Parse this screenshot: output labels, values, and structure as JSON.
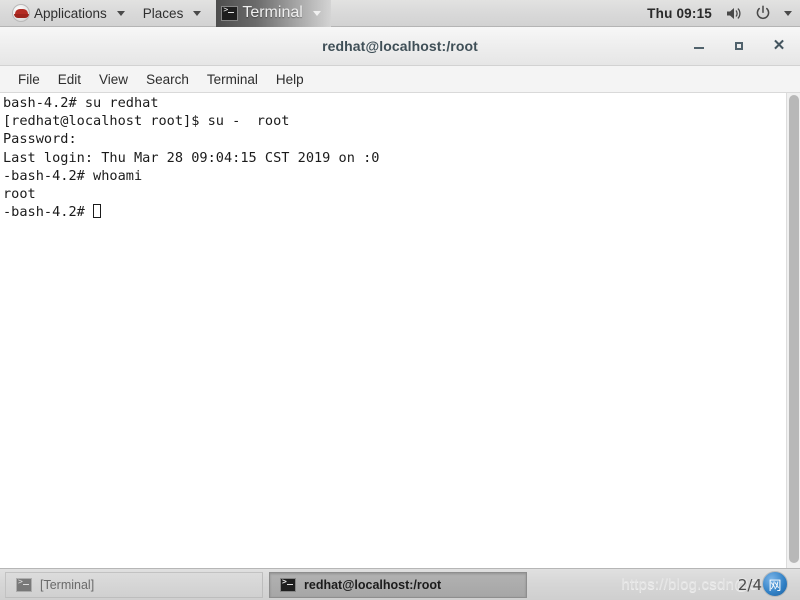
{
  "top_panel": {
    "logo_icon": "redhat-logo-icon",
    "applications_label": "Applications",
    "places_label": "Places",
    "window_menu_label": "Terminal",
    "window_menu_icon": "terminal-icon",
    "clock": "Thu 09:15",
    "volume_icon": "volume-icon",
    "power_icon": "power-icon",
    "system_menu_arrow_icon": "chevron-down-icon"
  },
  "window": {
    "title": "redhat@localhost:/root",
    "minimize_label": "–",
    "maximize_label": "□",
    "close_label": "✕",
    "menus": [
      {
        "label": "File"
      },
      {
        "label": "Edit"
      },
      {
        "label": "View"
      },
      {
        "label": "Search"
      },
      {
        "label": "Terminal"
      },
      {
        "label": "Help"
      }
    ]
  },
  "terminal": {
    "lines": [
      "bash-4.2# su redhat",
      "[redhat@localhost root]$ su -  root",
      "Password:",
      "Last login: Thu Mar 28 09:04:15 CST 2019 on :0",
      "-bash-4.2# whoami",
      "root"
    ],
    "prompt": "-bash-4.2# ",
    "text_color": "#1b1b1b",
    "background_color": "#ffffff"
  },
  "taskbar": {
    "buttons": [
      {
        "label": "[Terminal]",
        "icon": "terminal-icon",
        "active": false
      },
      {
        "label": "redhat@localhost:/root",
        "icon": "terminal-icon",
        "active": true
      }
    ]
  },
  "watermark": {
    "url": "https://blog.csdn@5",
    "page_indicator": "2/4",
    "badge_glyph": "网"
  }
}
